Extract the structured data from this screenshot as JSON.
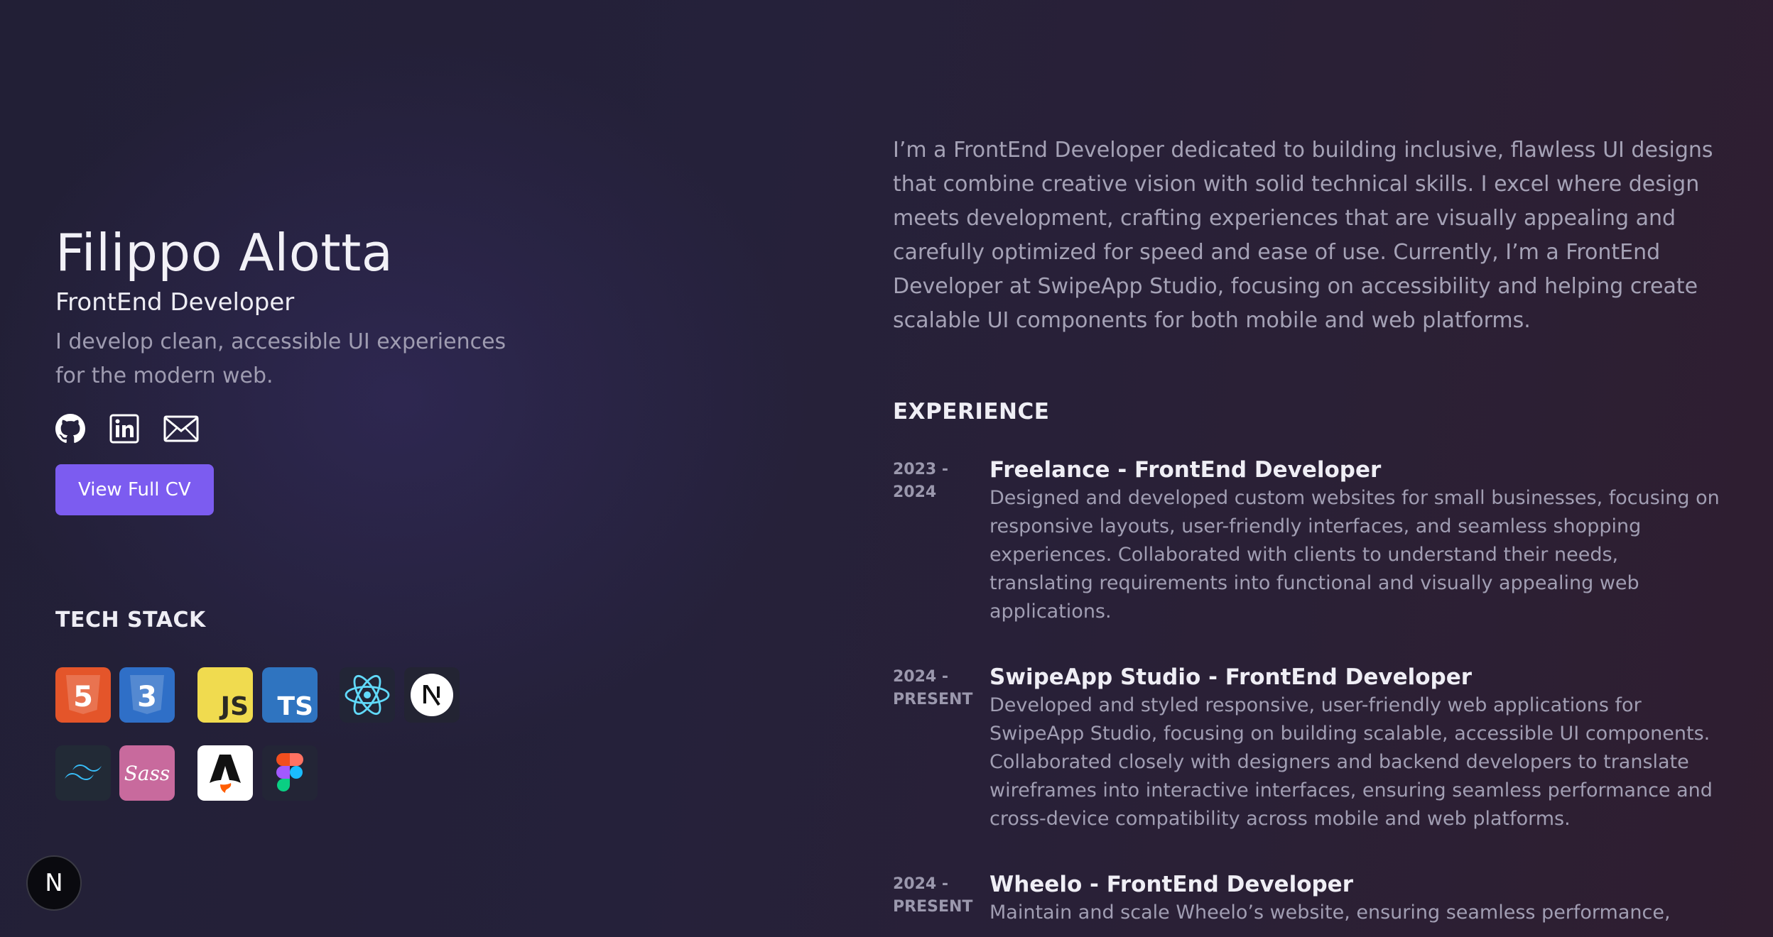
{
  "profile": {
    "name": "Filippo Alotta",
    "role": "FrontEnd Developer",
    "tagline": "I develop clean, accessible UI experiences for the modern web.",
    "socials": [
      {
        "icon": "github-icon",
        "label": "GitHub"
      },
      {
        "icon": "linkedin-icon",
        "label": "LinkedIn"
      },
      {
        "icon": "mail-icon",
        "label": "Email"
      }
    ],
    "cv_button": "View Full CV"
  },
  "tech_stack": {
    "title": "TECH STACK",
    "icons": [
      "html5-icon",
      "css3-icon",
      "javascript-icon",
      "typescript-icon",
      "react-icon",
      "nextjs-icon",
      "tailwind-icon",
      "sass-icon",
      "astro-icon",
      "figma-icon"
    ],
    "js_text": "JS",
    "ts_text": "TS",
    "html_text": "5",
    "css_text": "3",
    "sass_text": "Sass"
  },
  "about": "I’m a FrontEnd Developer dedicated to building inclusive, flawless UI designs that combine creative vision with solid technical skills. I excel where design meets development, crafting experiences that are visually appealing and carefully optimized for speed and ease of use. Currently, I’m a FrontEnd Developer at SwipeApp Studio, focusing on accessibility and helping create scalable UI components for both mobile and web platforms.",
  "experience": {
    "title": "EXPERIENCE",
    "items": [
      {
        "date_start": "2023 -",
        "date_end": "2024",
        "role": "Freelance - FrontEnd Developer",
        "description": "Designed and developed custom websites for small businesses, focusing on responsive layouts, user-friendly interfaces, and seamless shopping experiences. Collaborated with clients to understand their needs, translating requirements into functional and visually appealing web applications."
      },
      {
        "date_start": "2024 -",
        "date_end": "PRESENT",
        "role": "SwipeApp Studio - FrontEnd Developer",
        "description": "Developed and styled responsive, user-friendly web applications for SwipeApp Studio, focusing on building scalable, accessible UI components. Collaborated closely with designers and backend developers to translate wireframes into interactive interfaces, ensuring seamless performance and cross-device compatibility across mobile and web platforms."
      },
      {
        "date_start": "2024 -",
        "date_end": "PRESENT",
        "role": "Wheelo - FrontEnd Developer",
        "description": "Maintain and scale Wheelo’s website, ensuring seamless performance,"
      }
    ]
  },
  "colors": {
    "accent": "#7c5cf0",
    "background": "#25213a"
  },
  "dev_badge": {
    "icon": "nextjs-badge-icon",
    "letter": "N"
  }
}
